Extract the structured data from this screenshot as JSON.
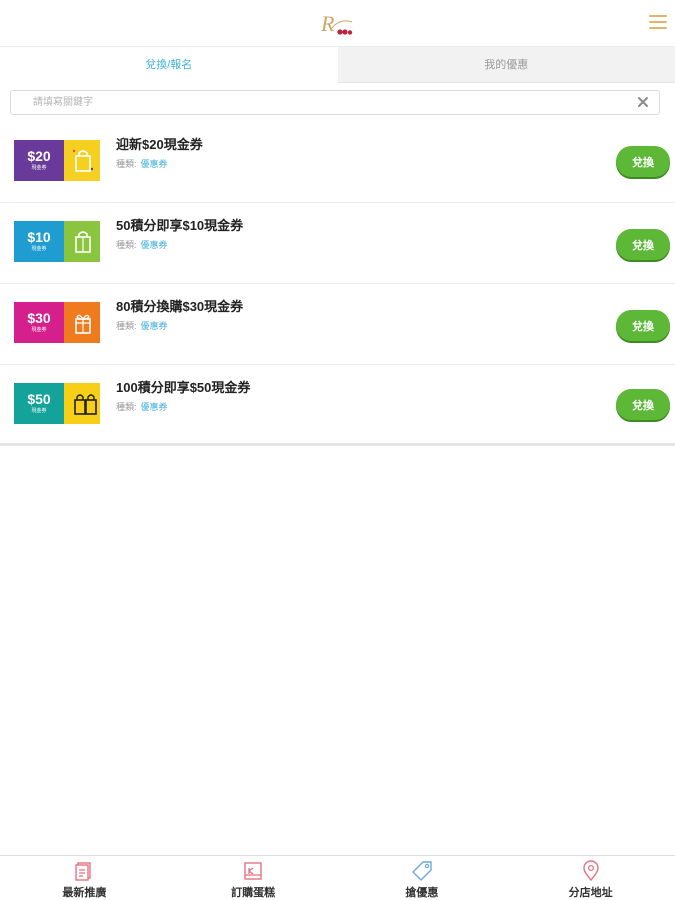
{
  "header": {
    "logo_letter": "R",
    "menu_icon": "hamburger-menu-icon"
  },
  "tabs": [
    {
      "label": "兌換/報名",
      "active": true
    },
    {
      "label": "我的優惠",
      "active": false
    }
  ],
  "search": {
    "placeholder": "請填寫關鍵字",
    "value": "",
    "clear_icon": "close-icon"
  },
  "coupons": [
    {
      "title": "迎新$20現金券",
      "category_label": "種類:",
      "category": "優惠券",
      "button": "兌換",
      "thumb_amount": "$20",
      "thumb_sub": "現金券",
      "color_left": "#6a3a9a",
      "color_right": "#f5d020"
    },
    {
      "title": "50積分即享$10現金券",
      "category_label": "種類:",
      "category": "優惠券",
      "button": "兌換",
      "thumb_amount": "$10",
      "thumb_sub": "現金券",
      "color_left": "#1f9dd0",
      "color_right": "#8bc43e"
    },
    {
      "title": "80積分換購$30現金券",
      "category_label": "種類:",
      "category": "優惠券",
      "button": "兌換",
      "thumb_amount": "$30",
      "thumb_sub": "現金券",
      "color_left": "#d41f8c",
      "color_right": "#f07b1e"
    },
    {
      "title": "100積分即享$50現金券",
      "category_label": "種類:",
      "category": "優惠券",
      "button": "兌換",
      "thumb_amount": "$50",
      "thumb_sub": "現金券",
      "color_left": "#13a39a",
      "color_right": "#f6cf16"
    }
  ],
  "bottom_nav": [
    {
      "label": "最新推廣",
      "icon": "promotion-icon"
    },
    {
      "label": "訂購蛋糕",
      "icon": "order-cake-icon"
    },
    {
      "label": "搶優惠",
      "icon": "coupon-tag-icon"
    },
    {
      "label": "分店地址",
      "icon": "location-pin-icon"
    }
  ],
  "colors": {
    "accent": "#3fb0dd",
    "button_green": "#5cb836",
    "nav_icon": "#e8727f",
    "gold": "#e0b56a"
  }
}
